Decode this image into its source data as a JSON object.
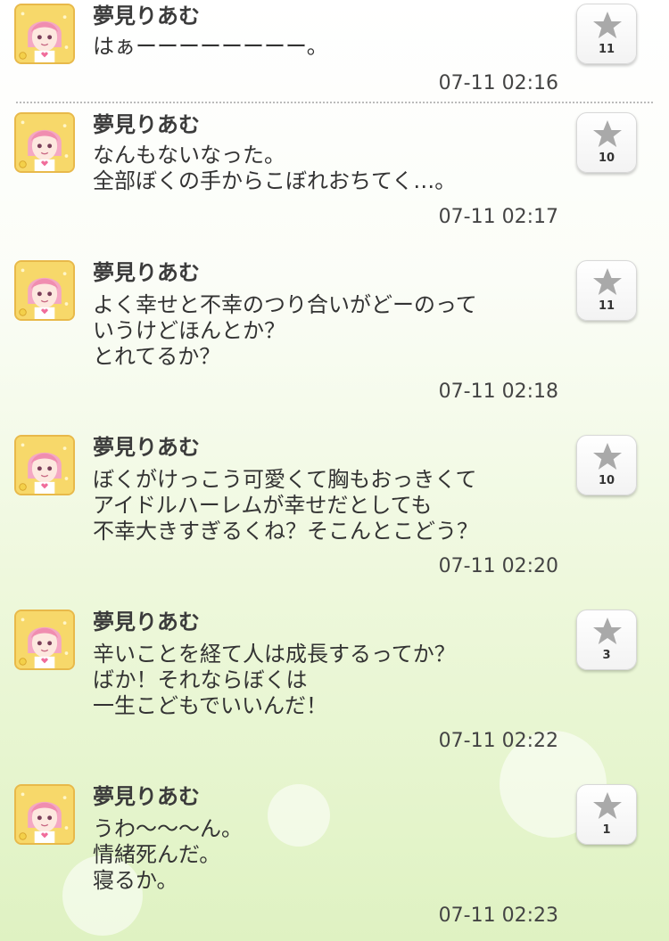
{
  "posts": [
    {
      "author": "夢見りあむ",
      "body": "はぁーーーーーーーー。",
      "time": "07-11 02:16",
      "likes": "11"
    },
    {
      "author": "夢見りあむ",
      "body": "なんもないなった。\n全部ぼくの手からこぼれおちてく…。",
      "time": "07-11 02:17",
      "likes": "10"
    },
    {
      "author": "夢見りあむ",
      "body": "よく幸せと不幸のつり合いがどーのって\nいうけどほんとか？\nとれてるか？",
      "time": "07-11 02:18",
      "likes": "11"
    },
    {
      "author": "夢見りあむ",
      "body": "ぼくがけっこう可愛くて胸もおっきくて\nアイドルハーレムが幸せだとしても\n不幸大きすぎるくね？そこんとこどう？",
      "time": "07-11 02:20",
      "likes": "10"
    },
    {
      "author": "夢見りあむ",
      "body": "辛いことを経て人は成長するってか？\nばか！それならぼくは\n一生こどもでいいんだ！",
      "time": "07-11 02:22",
      "likes": "3"
    },
    {
      "author": "夢見りあむ",
      "body": "うわ～～～ん。\n情緒死んだ。\n寝るか。",
      "time": "07-11 02:23",
      "likes": "1"
    }
  ],
  "icons": {
    "like": "star-icon",
    "avatar": "character-avatar"
  },
  "colors": {
    "background_top": "#ffffff",
    "background_bottom": "#dff2c2",
    "avatar_frame": "#f7d86a",
    "star": "#a9a9a9"
  }
}
